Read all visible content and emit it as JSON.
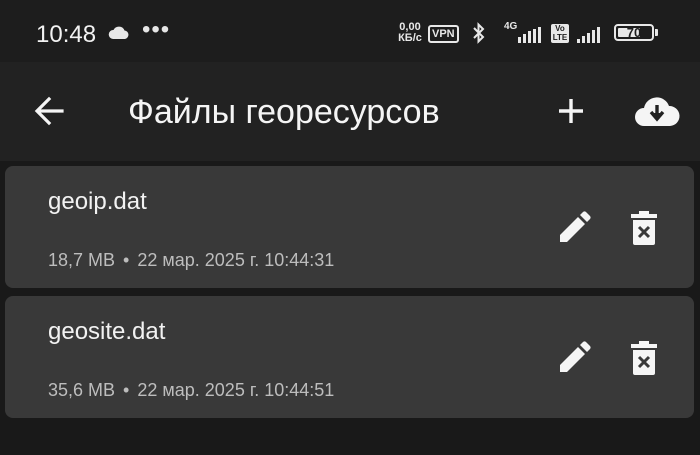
{
  "status_bar": {
    "time": "10:48",
    "overflow": "•••",
    "speed_value": "0,00",
    "speed_unit": "КБ/с",
    "vpn": "VPN",
    "network": "4G",
    "volte_top": "Vo",
    "volte_bottom": "LTE",
    "battery_percent": "70",
    "battery_level": 0.7,
    "icons": [
      "cloud-icon",
      "bluetooth-icon",
      "signal-icon",
      "battery-icon"
    ]
  },
  "app_bar": {
    "title": "Файлы георесурсов",
    "back_icon": "arrow-left-icon",
    "add_icon": "plus-icon",
    "download_icon": "cloud-download-icon"
  },
  "files": [
    {
      "name": "geoip.dat",
      "size": "18,7 MB",
      "separator": "•",
      "date": "22 мар. 2025 г. 10:44:31"
    },
    {
      "name": "geosite.dat",
      "size": "35,6 MB",
      "separator": "•",
      "date": "22 мар. 2025 г. 10:44:51"
    }
  ],
  "colors": {
    "background": "#191919",
    "app_bar": "#222222",
    "card": "#393939",
    "text": "#f2f2f2",
    "secondary_text": "#bdbdbd"
  }
}
